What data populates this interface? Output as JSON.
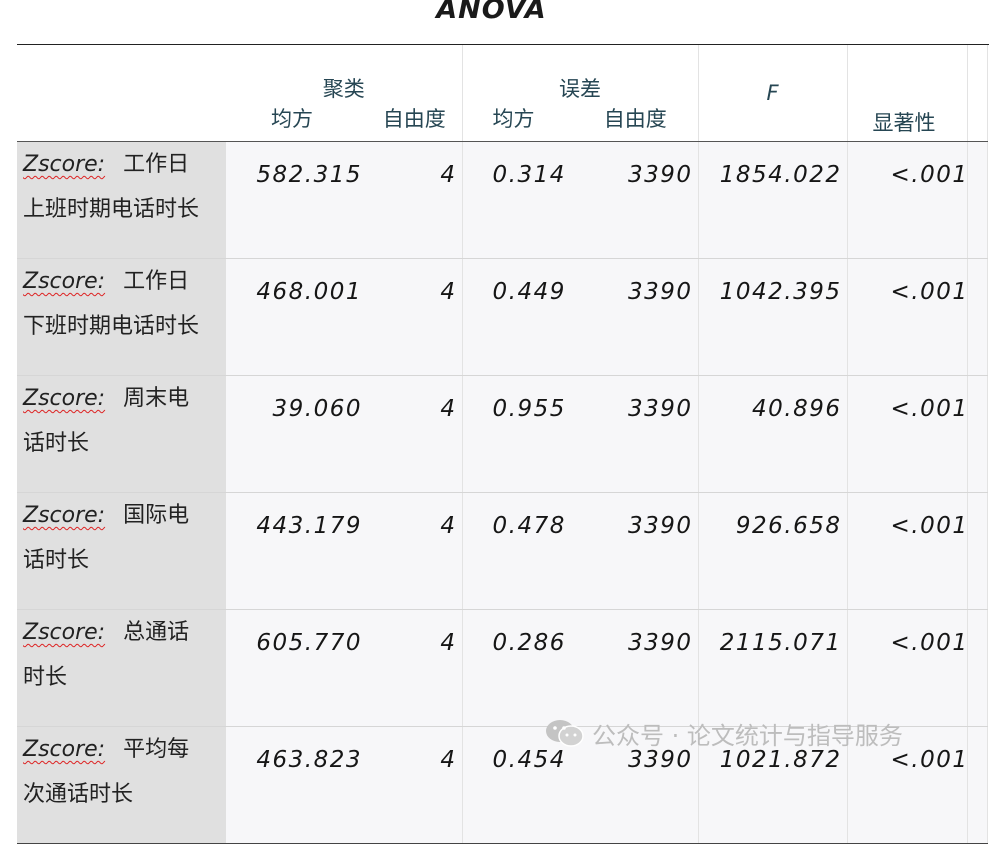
{
  "title": "ANOVA",
  "headers": {
    "cluster": "聚类",
    "error": "误差",
    "mean_square": "均方",
    "df": "自由度",
    "f": "F",
    "sig": "显著性"
  },
  "row_prefix": "Zscore:",
  "rows": [
    {
      "name_a": "工作日",
      "name_b": "上班时期电话时长",
      "ms_cluster": "582.315",
      "df_cluster": "4",
      "ms_error": "0.314",
      "df_error": "3390",
      "f": "1854.022",
      "sig": "<.001"
    },
    {
      "name_a": "工作日",
      "name_b": "下班时期电话时长",
      "ms_cluster": "468.001",
      "df_cluster": "4",
      "ms_error": "0.449",
      "df_error": "3390",
      "f": "1042.395",
      "sig": "<.001"
    },
    {
      "name_a": "周末电",
      "name_b": "话时长",
      "ms_cluster": "39.060",
      "df_cluster": "4",
      "ms_error": "0.955",
      "df_error": "3390",
      "f": "40.896",
      "sig": "<.001"
    },
    {
      "name_a": "国际电",
      "name_b": "话时长",
      "ms_cluster": "443.179",
      "df_cluster": "4",
      "ms_error": "0.478",
      "df_error": "3390",
      "f": "926.658",
      "sig": "<.001"
    },
    {
      "name_a": "总通话",
      "name_b": "时长",
      "ms_cluster": "605.770",
      "df_cluster": "4",
      "ms_error": "0.286",
      "df_error": "3390",
      "f": "2115.071",
      "sig": "<.001"
    },
    {
      "name_a": "平均每",
      "name_b": "次通话时长",
      "ms_cluster": "463.823",
      "df_cluster": "4",
      "ms_error": "0.454",
      "df_error": "3390",
      "f": "1021.872",
      "sig": "<.001"
    }
  ],
  "watermark": {
    "text": "公众号 · 论文统计与指导服务",
    "icon": "wechat-icon"
  },
  "colors": {
    "header_text": "#264653",
    "label_bg": "#e0e0e0",
    "cell_bg": "#f7f7f9",
    "watermark": "#bdbdbd"
  }
}
